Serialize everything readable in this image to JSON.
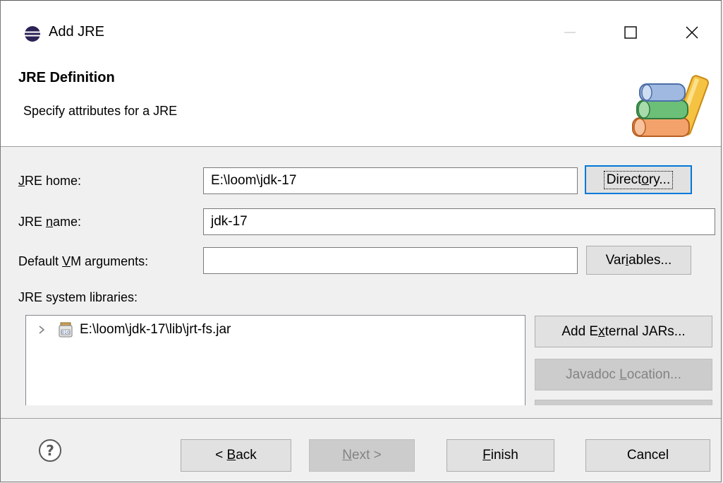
{
  "window": {
    "title": "Add JRE",
    "controls": {
      "minimize": "minimize-icon",
      "maximize": "maximize-icon",
      "close": "close-icon"
    }
  },
  "banner": {
    "title": "JRE Definition",
    "description": "Specify attributes for a JRE",
    "image": "jre-books-icon"
  },
  "form": {
    "jre_home": {
      "label_pre": "",
      "label_u": "J",
      "label_post": "RE home:",
      "value": "E:\\loom\\jdk-17"
    },
    "jre_name": {
      "label_pre": "JRE ",
      "label_u": "n",
      "label_post": "ame:",
      "value": "jdk-17"
    },
    "vm_args": {
      "label_pre": "Default ",
      "label_u": "V",
      "label_post": "M arguments:",
      "value": ""
    },
    "libraries_label": "JRE system libraries:",
    "libraries": [
      {
        "path": "E:\\loom\\jdk-17\\lib\\jrt-fs.jar",
        "expanded": false
      }
    ]
  },
  "buttons": {
    "directory": {
      "pre": "Direct",
      "u": "o",
      "post": "ry..."
    },
    "variables": {
      "pre": "Var",
      "u": "i",
      "post": "ables..."
    },
    "add_external_jars": {
      "pre": "Add E",
      "u": "x",
      "post": "ternal JARs..."
    },
    "javadoc_location": {
      "pre": "Javadoc ",
      "u": "L",
      "post": "ocation..."
    },
    "back": {
      "pre": "< ",
      "u": "B",
      "post": "ack"
    },
    "next": {
      "pre": "",
      "u": "N",
      "post": "ext >"
    },
    "finish": {
      "pre": "",
      "u": "F",
      "post": "inish"
    },
    "cancel": "Cancel"
  },
  "colors": {
    "focus_border": "#0078d7",
    "disabled_bg": "#cccccc",
    "disabled_text": "#838383"
  }
}
